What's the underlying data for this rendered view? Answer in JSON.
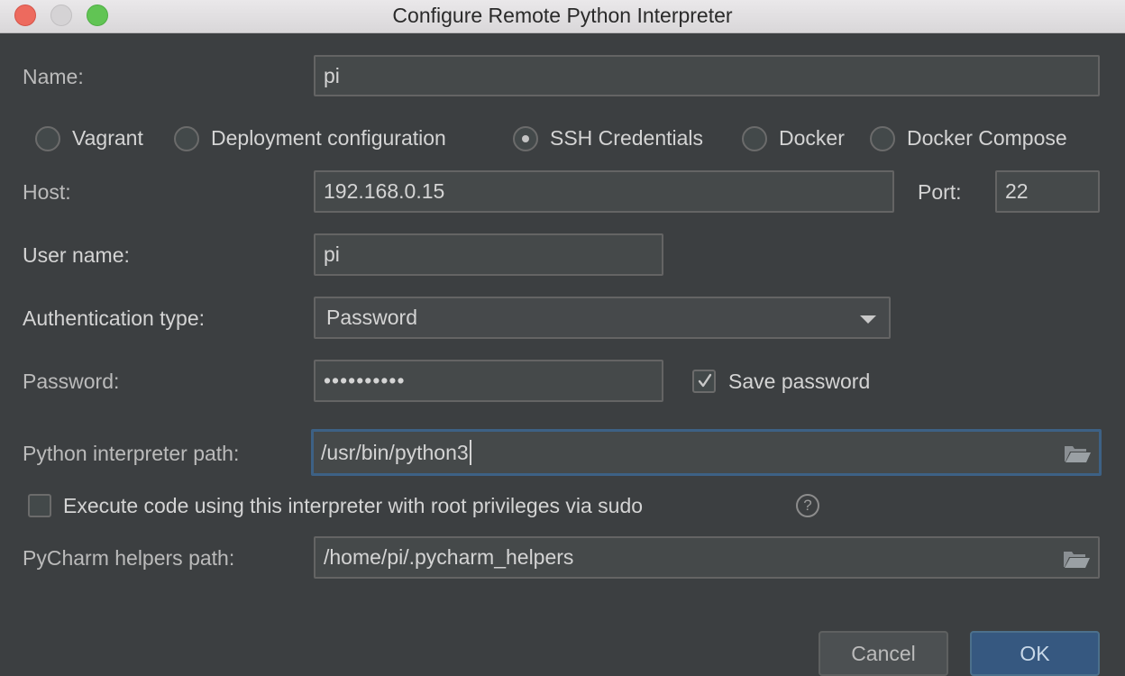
{
  "window": {
    "title": "Configure Remote Python Interpreter"
  },
  "name": {
    "label": "Name:",
    "value": "pi"
  },
  "connection_types": [
    {
      "label": "Vagrant",
      "selected": false
    },
    {
      "label": "Deployment configuration",
      "selected": false
    },
    {
      "label": "SSH Credentials",
      "selected": true
    },
    {
      "label": "Docker",
      "selected": false
    },
    {
      "label": "Docker Compose",
      "selected": false
    }
  ],
  "host": {
    "label": "Host:",
    "value": "192.168.0.15"
  },
  "port": {
    "label": "Port:",
    "value": "22"
  },
  "user_name": {
    "label": "User name:",
    "value": "pi"
  },
  "auth_type": {
    "label": "Authentication type:",
    "value": "Password"
  },
  "password": {
    "label": "Password:",
    "value": "••••••••••"
  },
  "save_password": {
    "label": "Save password",
    "checked": true
  },
  "interpreter_path": {
    "label": "Python interpreter path:",
    "value": "/usr/bin/python3"
  },
  "sudo": {
    "label": "Execute code using this interpreter with root privileges via sudo",
    "checked": false,
    "help_glyph": "?"
  },
  "helpers_path": {
    "label": "PyCharm helpers path:",
    "value": "/home/pi/.pycharm_helpers"
  },
  "buttons": {
    "cancel": "Cancel",
    "ok": "OK"
  },
  "icons": {
    "folder": "folder-open-icon",
    "help": "help-icon",
    "dropdown": "chevron-down-icon",
    "check": "check-icon"
  },
  "colors": {
    "background": "#3c3f41",
    "field": "#45494a",
    "focus_border": "#3d6185",
    "ok_button": "#365880"
  }
}
